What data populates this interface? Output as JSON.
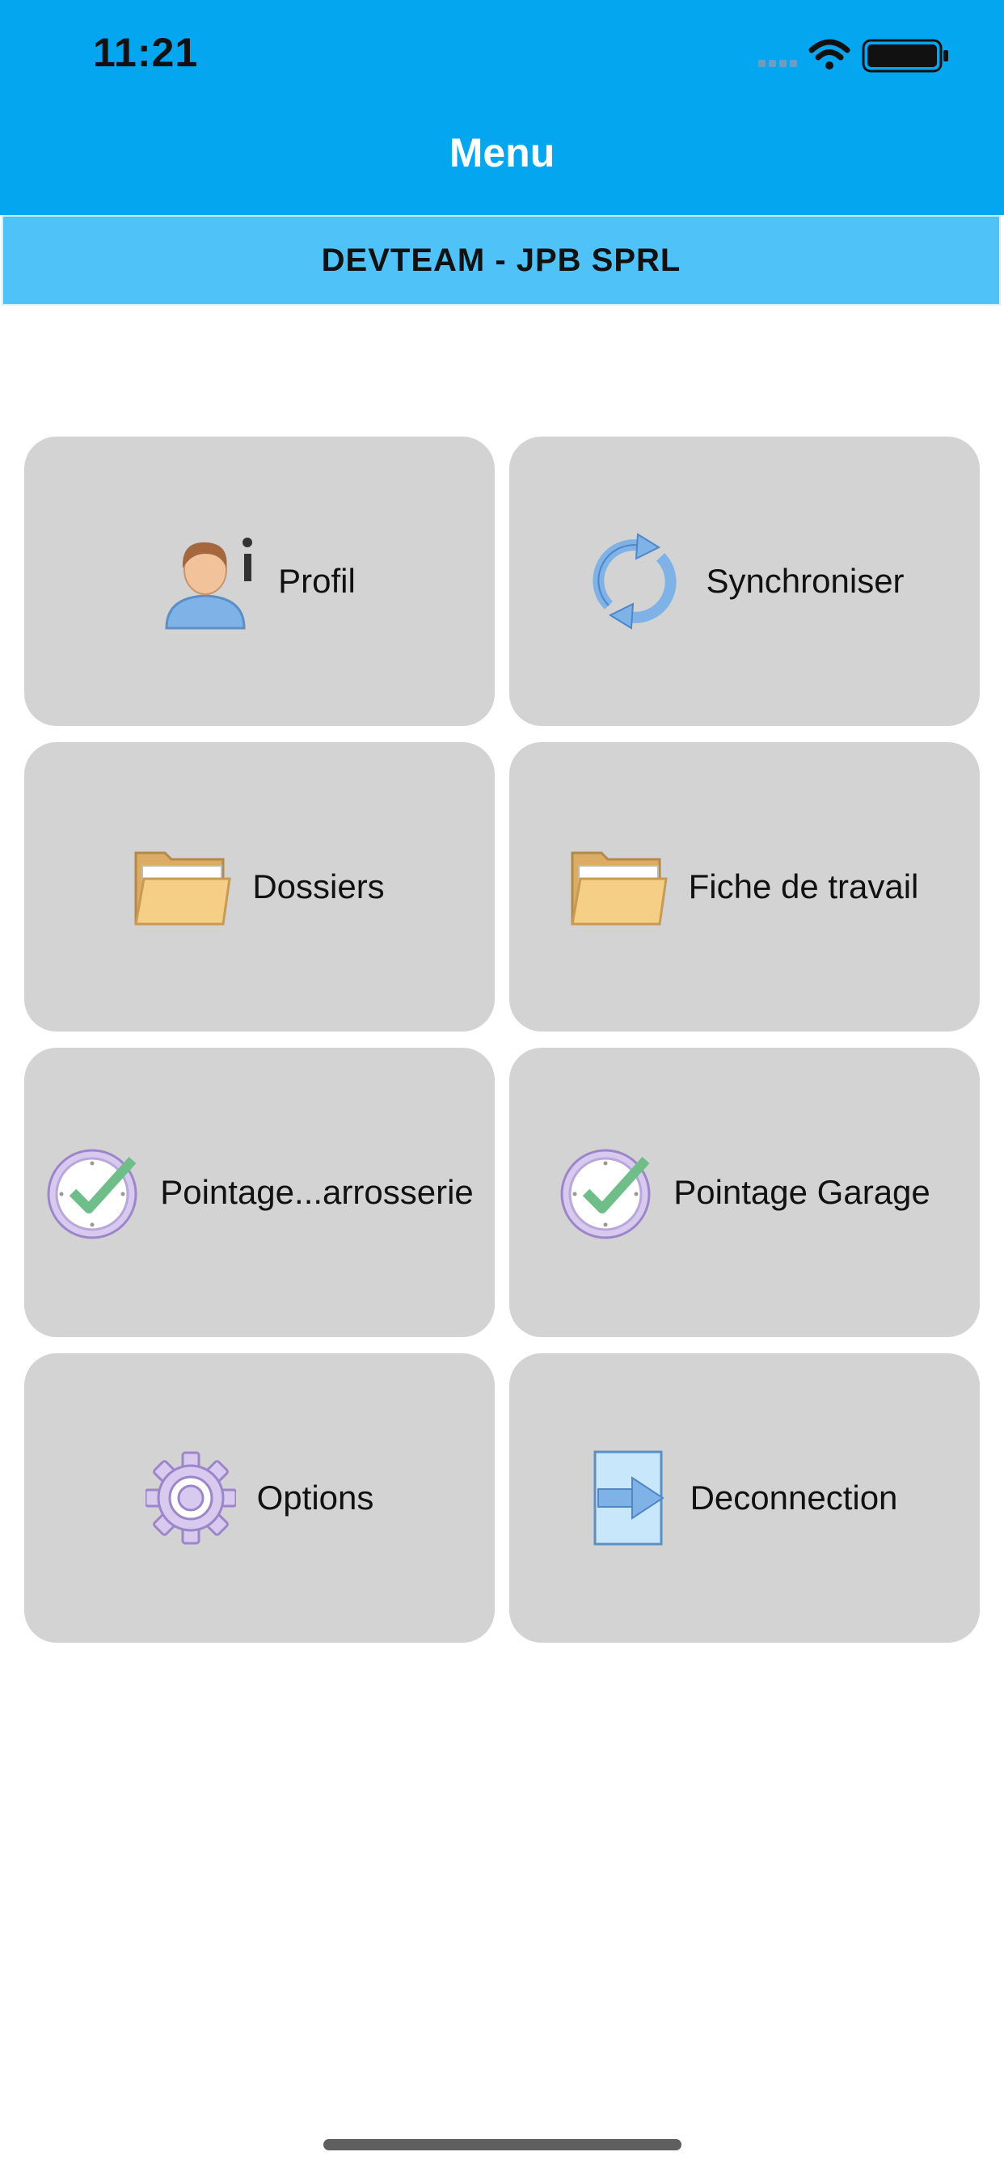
{
  "status_bar": {
    "time": "11:21"
  },
  "nav": {
    "title": "Menu"
  },
  "company": {
    "name": "DEVTEAM - JPB SPRL"
  },
  "menu": {
    "items": [
      {
        "label": "Profil",
        "icon": "user-info-icon"
      },
      {
        "label": "Synchroniser",
        "icon": "sync-icon"
      },
      {
        "label": "Dossiers",
        "icon": "folder-icon"
      },
      {
        "label": "Fiche de travail",
        "icon": "folder-icon"
      },
      {
        "label": "Pointage...arrosserie",
        "icon": "clock-check-icon"
      },
      {
        "label": "Pointage Garage",
        "icon": "clock-check-icon"
      },
      {
        "label": "Options",
        "icon": "gear-icon"
      },
      {
        "label": "Deconnection",
        "icon": "logout-icon"
      }
    ]
  },
  "colors": {
    "nav_background": "#05A6F0",
    "company_bar_background": "#4FC3F7",
    "tile_background": "#D3D3D3"
  }
}
